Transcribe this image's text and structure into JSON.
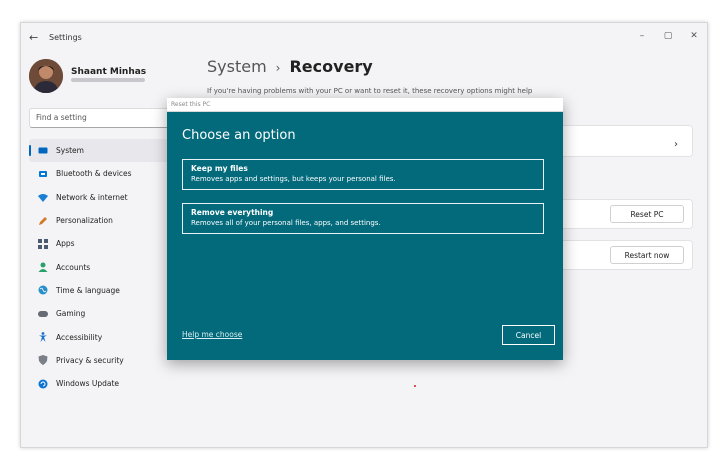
{
  "window": {
    "title": "Settings",
    "controls": {
      "minimize": "–",
      "maximize": "▢",
      "close": "✕"
    }
  },
  "profile": {
    "name": "Shaant Minhas"
  },
  "search": {
    "placeholder": "Find a setting"
  },
  "sidebar": {
    "items": [
      {
        "label": "System",
        "icon": "monitor-icon",
        "color": "#0067c0",
        "active": true
      },
      {
        "label": "Bluetooth & devices",
        "icon": "bluetooth-icon",
        "color": "#0078d4"
      },
      {
        "label": "Network & internet",
        "icon": "wifi-icon",
        "color": "#1a7fd4"
      },
      {
        "label": "Personalization",
        "icon": "pen-icon",
        "color": "#d07a2a"
      },
      {
        "label": "Apps",
        "icon": "apps-icon",
        "color": "#4a5a70"
      },
      {
        "label": "Accounts",
        "icon": "person-icon",
        "color": "#2aa06a"
      },
      {
        "label": "Time & language",
        "icon": "globe-icon",
        "color": "#2a8fc8"
      },
      {
        "label": "Gaming",
        "icon": "gamepad-icon",
        "color": "#666a72"
      },
      {
        "label": "Accessibility",
        "icon": "accessibility-icon",
        "color": "#1a6fc8"
      },
      {
        "label": "Privacy & security",
        "icon": "shield-icon",
        "color": "#7a7f88"
      },
      {
        "label": "Windows Update",
        "icon": "update-icon",
        "color": "#0a74d0"
      }
    ]
  },
  "main": {
    "breadcrumb": {
      "parent": "System",
      "separator": "›",
      "current": "Recovery"
    },
    "intro": "If you're having problems with your PC or want to reset it, these recovery options might help",
    "cards": {
      "reset_button": "Reset PC",
      "restart_button": "Restart now",
      "chevron": "›"
    }
  },
  "dialog": {
    "title": "Reset this PC",
    "heading": "Choose an option",
    "options": [
      {
        "title": "Keep my files",
        "description": "Removes apps and settings, but keeps your personal files."
      },
      {
        "title": "Remove everything",
        "description": "Removes all of your personal files, apps, and settings."
      }
    ],
    "help_link": "Help me choose",
    "cancel": "Cancel"
  },
  "colors": {
    "dialog_bg": "#036a7c",
    "accent": "#0067c0"
  }
}
